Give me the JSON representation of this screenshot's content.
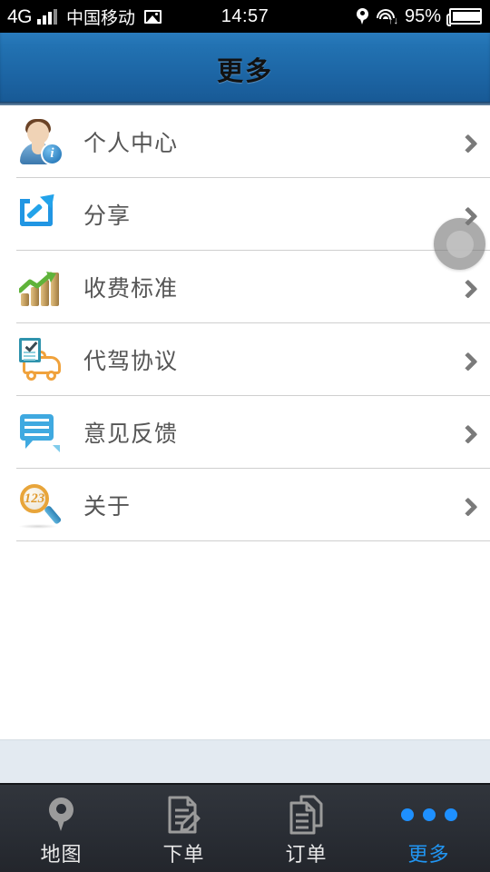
{
  "statusbar": {
    "network": "4G",
    "carrier": "中国移动",
    "time": "14:57",
    "battery_pct": "95%",
    "icons": [
      "signal-bars-icon",
      "photo-icon",
      "location-pin-icon",
      "wifi-icon",
      "battery-icon"
    ]
  },
  "header": {
    "title": "更多"
  },
  "list": {
    "items": [
      {
        "label": "个人中心",
        "icon": "person-info-icon"
      },
      {
        "label": "分享",
        "icon": "share-icon"
      },
      {
        "label": "收费标准",
        "icon": "bar-chart-coins-icon"
      },
      {
        "label": "代驾协议",
        "icon": "car-agreement-icon"
      },
      {
        "label": "意见反馈",
        "icon": "feedback-bubbles-icon"
      },
      {
        "label": "关于",
        "icon": "magnifier-123-icon"
      }
    ]
  },
  "floating_ball": {
    "icon": "assistive-touch-ball"
  },
  "tabbar": {
    "items": [
      {
        "label": "地图",
        "icon": "map-pin-icon",
        "active": false
      },
      {
        "label": "下单",
        "icon": "order-form-icon",
        "active": false
      },
      {
        "label": "订单",
        "icon": "documents-icon",
        "active": false
      },
      {
        "label": "更多",
        "icon": "more-dots-icon",
        "active": true
      }
    ]
  },
  "colors": {
    "header_blue": "#1c64a3",
    "accent_blue": "#2196f3",
    "tabbar_dark": "#2a2e35",
    "divider": "#cfcfcf",
    "panel_blue_gray": "#e3eaf1"
  }
}
